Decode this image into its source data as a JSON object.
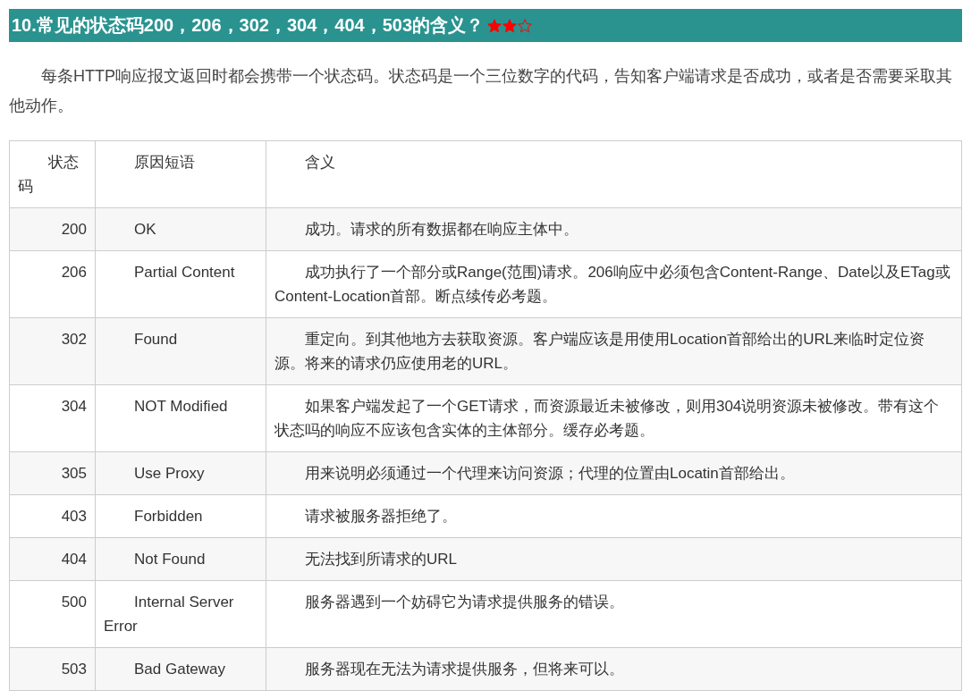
{
  "heading": {
    "title": "10.常见的状态码200，206，302，304，404，503的含义？",
    "stars": 2
  },
  "intro": "每条HTTP响应报文返回时都会携带一个状态码。状态码是一个三位数字的代码，告知客户端请求是否成功，或者是否需要采取其他动作。",
  "table": {
    "columns": [
      "状态码",
      "原因短语",
      "含义"
    ],
    "rows": [
      {
        "code": "200",
        "phrase": "OK",
        "meaning": "成功。请求的所有数据都在响应主体中。"
      },
      {
        "code": "206",
        "phrase": "Partial Content",
        "meaning": "成功执行了一个部分或Range(范围)请求。206响应中必须包含Content-Range、Date以及ETag或Content-Location首部。断点续传必考题。"
      },
      {
        "code": "302",
        "phrase": "Found",
        "meaning": "重定向。到其他地方去获取资源。客户端应该是用使用Location首部给出的URL来临时定位资源。将来的请求仍应使用老的URL。"
      },
      {
        "code": "304",
        "phrase": "NOT Modified",
        "meaning": "如果客户端发起了一个GET请求，而资源最近未被修改，则用304说明资源未被修改。带有这个状态吗的响应不应该包含实体的主体部分。缓存必考题。"
      },
      {
        "code": "305",
        "phrase": "Use Proxy",
        "meaning": "用来说明必须通过一个代理来访问资源；代理的位置由Locatin首部给出。"
      },
      {
        "code": "403",
        "phrase": "Forbidden",
        "meaning": "请求被服务器拒绝了。"
      },
      {
        "code": "404",
        "phrase": "Not Found",
        "meaning": "无法找到所请求的URL"
      },
      {
        "code": "500",
        "phrase": "Internal Server Error",
        "meaning": "服务器遇到一个妨碍它为请求提供服务的错误。"
      },
      {
        "code": "503",
        "phrase": "Bad Gateway",
        "meaning": "服务器现在无法为请求提供服务，但将来可以。"
      }
    ]
  }
}
